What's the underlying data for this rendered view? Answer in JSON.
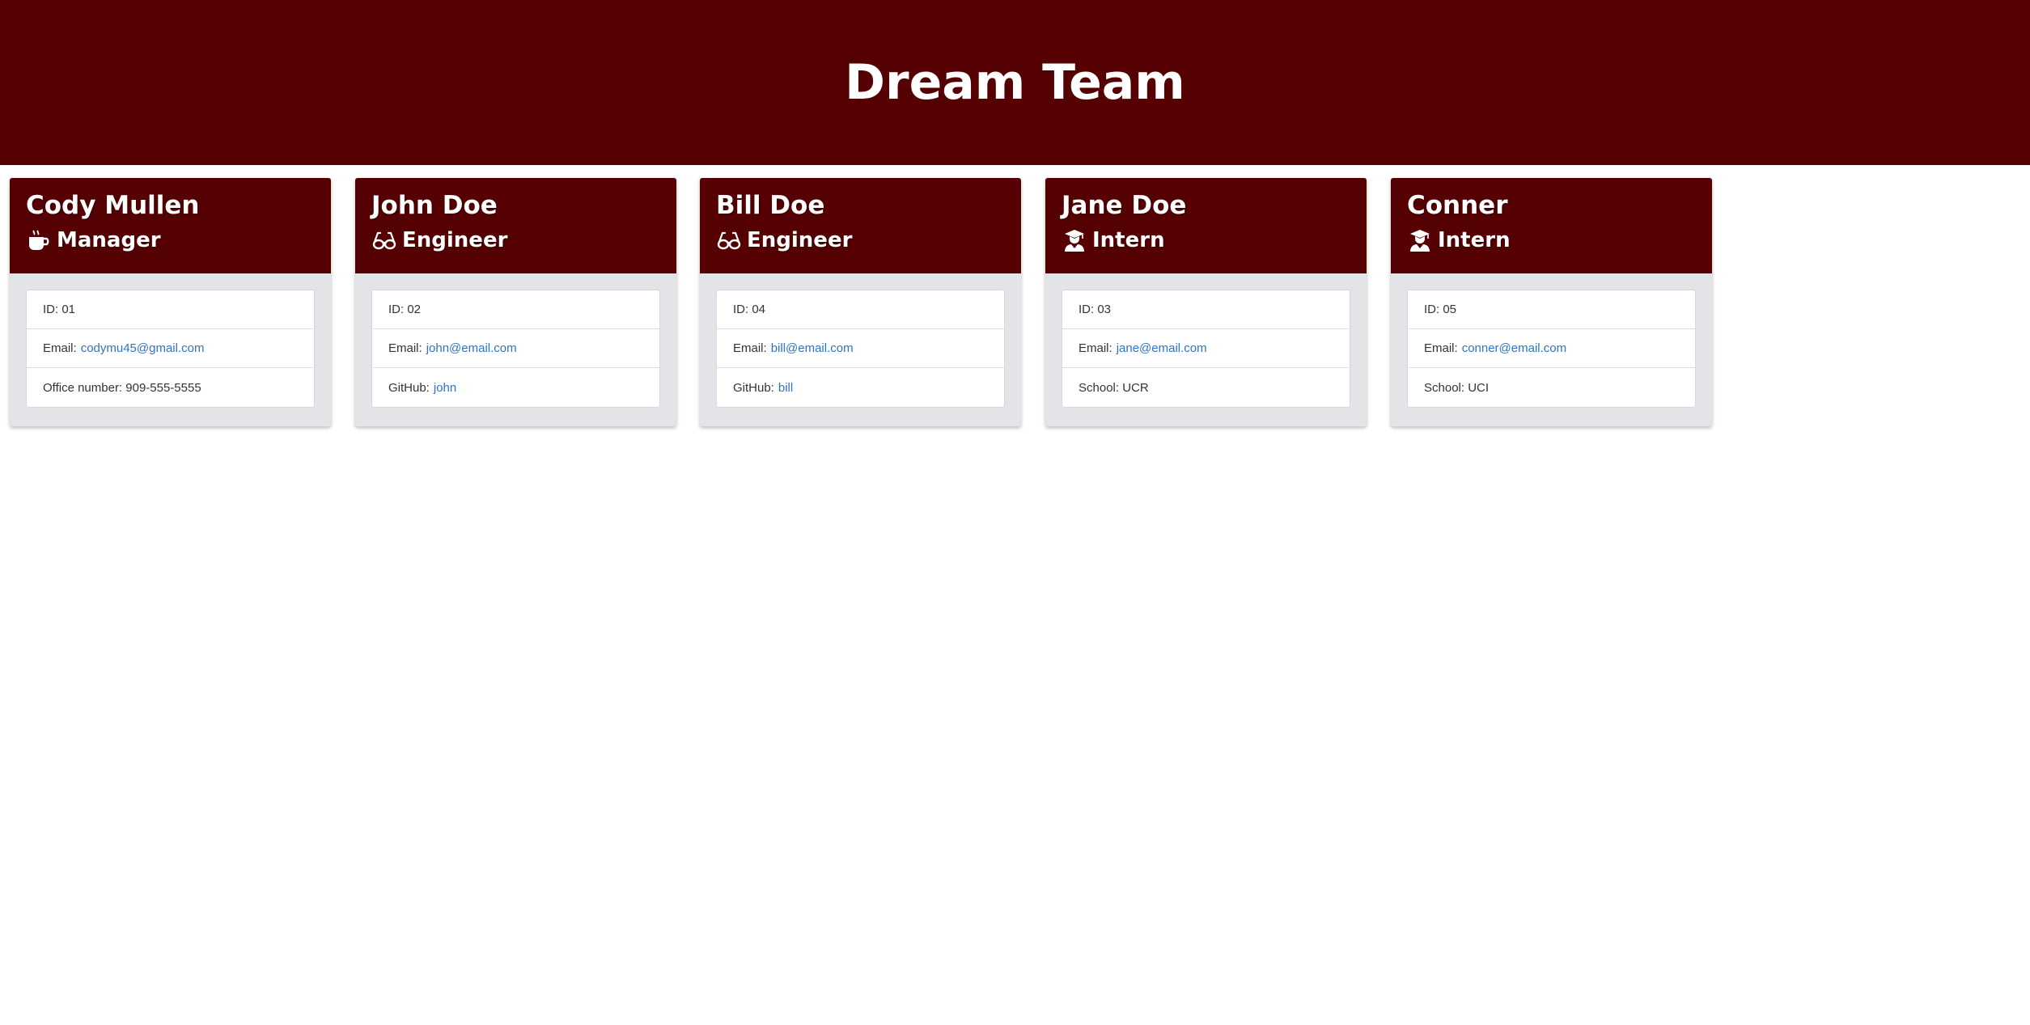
{
  "header": {
    "title": "Dream Team"
  },
  "colors": {
    "brand": "#550002",
    "card_body": "#e3e4e8",
    "link": "#2f73c5"
  },
  "employees": [
    {
      "name": "Cody Mullen",
      "role": "Manager",
      "icon": "coffee-mug-icon",
      "id_label": "ID: 01",
      "email_label": "Email:",
      "email": "codymu45@gmail.com",
      "extra_label": "Office number: 909-555-5555",
      "extra_link": ""
    },
    {
      "name": "John Doe",
      "role": "Engineer",
      "icon": "glasses-icon",
      "id_label": "ID: 02",
      "email_label": "Email:",
      "email": "john@email.com",
      "extra_label": "GitHub:",
      "extra_link": "john"
    },
    {
      "name": "Bill Doe",
      "role": "Engineer",
      "icon": "glasses-icon",
      "id_label": "ID: 04",
      "email_label": "Email:",
      "email": "bill@email.com",
      "extra_label": "GitHub:",
      "extra_link": "bill"
    },
    {
      "name": "Jane Doe",
      "role": "Intern",
      "icon": "graduate-icon",
      "id_label": "ID: 03",
      "email_label": "Email:",
      "email": "jane@email.com",
      "extra_label": "School: UCR",
      "extra_link": ""
    },
    {
      "name": "Conner",
      "role": "Intern",
      "icon": "graduate-icon",
      "id_label": "ID: 05",
      "email_label": "Email:",
      "email": "conner@email.com",
      "extra_label": "School: UCI",
      "extra_link": ""
    }
  ]
}
